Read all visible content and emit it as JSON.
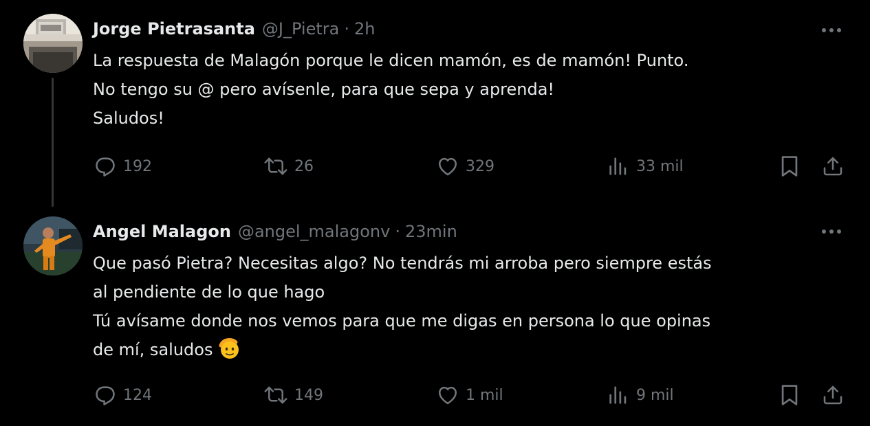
{
  "colors": {
    "background": "#000000",
    "text_primary": "#e7e9ea",
    "text_secondary": "#71767b",
    "thread_line": "#333639"
  },
  "icons": {
    "reply": "reply-icon",
    "retweet": "retweet-icon",
    "like": "heart-icon",
    "views": "views-chart-icon",
    "bookmark": "bookmark-icon",
    "share": "share-icon",
    "more": "more-options-icon"
  },
  "tweets": [
    {
      "display_name": "Jorge Pietrasanta",
      "handle": "@J_Pietra",
      "separator": "·",
      "time": "2h",
      "lines": [
        "La respuesta de Malagón porque le dicen mamón, es de mamón! Punto.",
        "No tengo su @ pero avísenle, para que sepa y aprenda!",
        "Saludos!"
      ],
      "stats": {
        "replies": "192",
        "retweets": "26",
        "likes": "329",
        "views": "33 mil"
      }
    },
    {
      "display_name": "Angel Malagon",
      "handle": "@angel_malagonv",
      "separator": "·",
      "time": "23min",
      "lines": [
        "Que pasó Pietra? Necesitas algo? No tendrás mi arroba pero siempre estás",
        "al pendiente de lo que hago",
        "Tú avísame donde nos vemos para que me digas en persona lo que opinas",
        "de mí, saludos"
      ],
      "emoji": "saluting-face-emoji",
      "stats": {
        "replies": "124",
        "retweets": "149",
        "likes": "1 mil",
        "views": "9 mil"
      }
    }
  ]
}
